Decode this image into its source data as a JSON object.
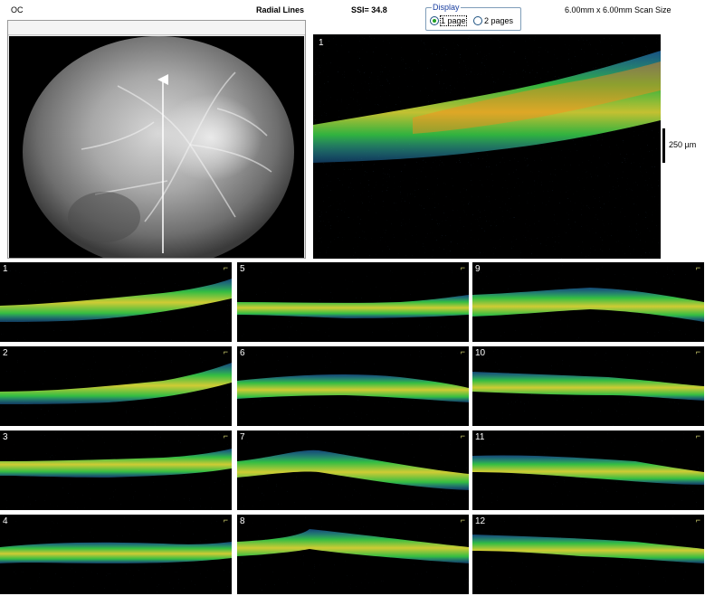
{
  "header": {
    "eye": "OC",
    "mode": "Radial Lines",
    "ssi": "SSI= 34.8",
    "scan_size": "6.00mm x 6.00mm Scan Size"
  },
  "display": {
    "legend": "Display",
    "options": [
      "1 page",
      "2 pages"
    ],
    "selected": "1 page"
  },
  "main_scan": {
    "number": "1"
  },
  "scale": {
    "label": "250 µm"
  },
  "thumbnails": [
    {
      "number": "1"
    },
    {
      "number": "5"
    },
    {
      "number": "9"
    },
    {
      "number": "2"
    },
    {
      "number": "6"
    },
    {
      "number": "10"
    },
    {
      "number": "3"
    },
    {
      "number": "7"
    },
    {
      "number": "11"
    },
    {
      "number": "4"
    },
    {
      "number": "8"
    },
    {
      "number": "12"
    }
  ],
  "colors": {
    "background": "#000000",
    "retina_outer": "#2fa0ff",
    "retina_mid": "#39d24a",
    "retina_core": "#e6e23a",
    "retina_hot": "#ff8a1a"
  }
}
